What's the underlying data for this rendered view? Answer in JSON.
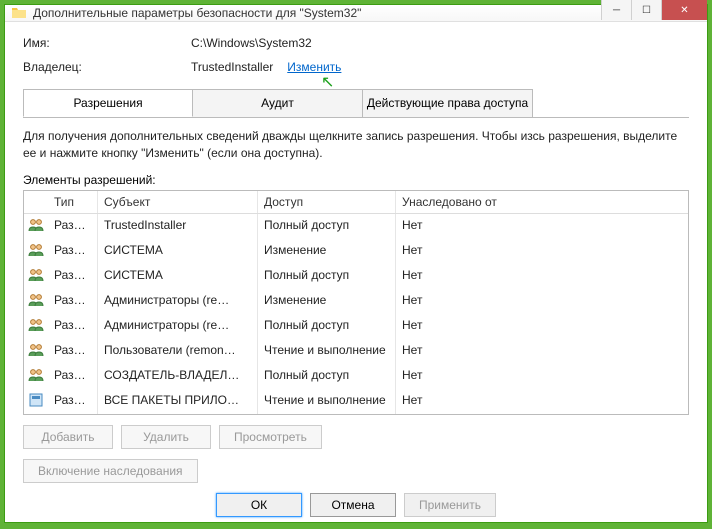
{
  "window": {
    "title": "Дополнительные параметры безопасности  для \"System32\""
  },
  "info": {
    "name_label": "Имя:",
    "name_value": "C:\\Windows\\System32",
    "owner_label": "Владелец:",
    "owner_value": "TrustedInstaller",
    "change_link": "Изменить"
  },
  "tabs": {
    "permissions": "Разрешения",
    "audit": "Аудит",
    "effective": "Действующие права доступа"
  },
  "desc": "Для получения дополнительных сведений дважды щелкните запись разрешения. Чтобы изсь разрешения, выделите ее и нажмите кнопку \"Изменить\" (если она доступна).",
  "list_label": "Элементы разрешений:",
  "columns": {
    "type": "Тип",
    "subject": "Субъект",
    "access": "Доступ",
    "inherited": "Унаследовано от"
  },
  "rows": [
    {
      "icon": "users",
      "type": "Разр…",
      "subject": "TrustedInstaller",
      "access": "Полный доступ",
      "inherited": "Нет"
    },
    {
      "icon": "users",
      "type": "Разр…",
      "subject": "СИСТЕМА",
      "access": "Изменение",
      "inherited": "Нет"
    },
    {
      "icon": "users",
      "type": "Разр…",
      "subject": "СИСТЕМА",
      "access": "Полный доступ",
      "inherited": "Нет"
    },
    {
      "icon": "users",
      "type": "Разр…",
      "subject": "Администраторы (re…",
      "access": "Изменение",
      "inherited": "Нет"
    },
    {
      "icon": "users",
      "type": "Разр…",
      "subject": "Администраторы (re…",
      "access": "Полный доступ",
      "inherited": "Нет"
    },
    {
      "icon": "users",
      "type": "Разр…",
      "subject": "Пользователи (remon…",
      "access": "Чтение и выполнение",
      "inherited": "Нет"
    },
    {
      "icon": "users",
      "type": "Разр…",
      "subject": "СОЗДАТЕЛЬ-ВЛАДЕЛ…",
      "access": "Полный доступ",
      "inherited": "Нет"
    },
    {
      "icon": "package",
      "type": "Разр…",
      "subject": "ВСЕ ПАКЕТЫ ПРИЛО…",
      "access": "Чтение и выполнение",
      "inherited": "Нет"
    }
  ],
  "buttons": {
    "add": "Добавить",
    "remove": "Удалить",
    "view": "Просмотреть",
    "enable_inherit": "Включение наследования",
    "ok": "ОК",
    "cancel": "Отмена",
    "apply": "Применить"
  }
}
